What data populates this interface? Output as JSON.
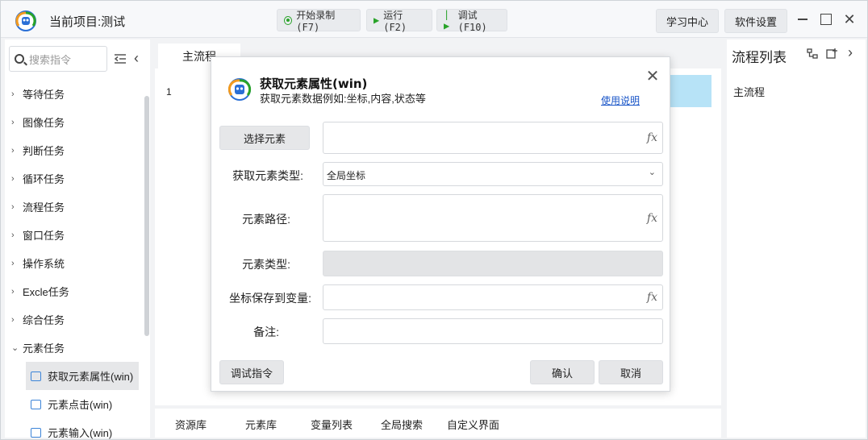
{
  "app": {
    "title": "当前项目:测试",
    "toolbar": {
      "record_label": "开始录制(F7)",
      "run_label": "运行(F2)",
      "debug_label": "调试(F10)"
    },
    "right_buttons": {
      "learn_label": "学习中心",
      "settings_label": "软件设置"
    },
    "window_controls": [
      "minimize",
      "maximize",
      "close"
    ]
  },
  "sidebar": {
    "search_placeholder": "搜索指令",
    "categories": [
      {
        "label": "等待任务"
      },
      {
        "label": "图像任务"
      },
      {
        "label": "判断任务"
      },
      {
        "label": "循环任务"
      },
      {
        "label": "流程任务"
      },
      {
        "label": "窗口任务"
      },
      {
        "label": "操作系统"
      },
      {
        "label": "Excle任务"
      },
      {
        "label": "综合任务"
      },
      {
        "label": "元素任务"
      }
    ],
    "sub_items": [
      {
        "label": "获取元素属性(win)"
      },
      {
        "label": "元素点击(win)"
      },
      {
        "label": "元素输入(win)"
      }
    ]
  },
  "editor": {
    "tab_label": "主流程",
    "line_number": "1"
  },
  "bottom_tabs": [
    "资源库",
    "元素库",
    "变量列表",
    "全局搜索",
    "自定义界面"
  ],
  "flow_panel": {
    "title": "流程列表",
    "items": [
      "主流程"
    ]
  },
  "dialog": {
    "title": "获取元素属性(win)",
    "subtitle": "获取元素数据例如:坐标,内容,状态等",
    "help_link": "使用说明",
    "select_element_label": "选择元素",
    "element_type_get_label": "获取元素类型:",
    "element_type_get_value": "全局坐标",
    "element_path_label": "元素路径:",
    "element_type_label": "元素类型:",
    "save_var_label": "坐标保存到变量:",
    "note_label": "备注:",
    "fx_label": "fx",
    "debug_button": "调试指令",
    "confirm_button": "确认",
    "cancel_button": "取消"
  },
  "colors": {
    "accent_green": "#29a329",
    "link_blue": "#1a56c8",
    "highlight_row": "#b7e3f7"
  }
}
